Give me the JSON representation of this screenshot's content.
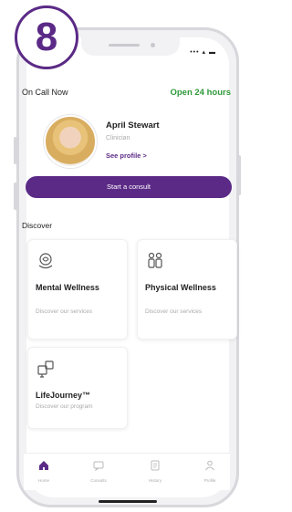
{
  "badge": {
    "number": "8"
  },
  "status_bar": {
    "icons_text": "••• ▴ ▬"
  },
  "on_call": {
    "label": "On Call Now",
    "hours": "Open 24 hours"
  },
  "clinician": {
    "name": "April Stewart",
    "role": "Clinician",
    "profile_link": "See profile >"
  },
  "consult_button": {
    "label": "Start a consult"
  },
  "discover": {
    "heading": "Discover",
    "cards": [
      {
        "title": "Mental Wellness",
        "subtitle": "Discover our services",
        "icon": "brain-heart-icon"
      },
      {
        "title": "Physical Wellness",
        "subtitle": "Discover our services",
        "icon": "people-icon"
      },
      {
        "title": "LifeJourney™",
        "subtitle": "Discover our program",
        "icon": "journey-icon"
      }
    ]
  },
  "nav": {
    "items": [
      {
        "label": "Home",
        "icon": "home-icon",
        "active": true
      },
      {
        "label": "Consults",
        "icon": "chat-icon",
        "active": false
      },
      {
        "label": "History",
        "icon": "document-icon",
        "active": false
      },
      {
        "label": "Profile",
        "icon": "person-icon",
        "active": false
      }
    ]
  },
  "colors": {
    "brand": "#5b2a86",
    "open": "#2f9a3a"
  }
}
